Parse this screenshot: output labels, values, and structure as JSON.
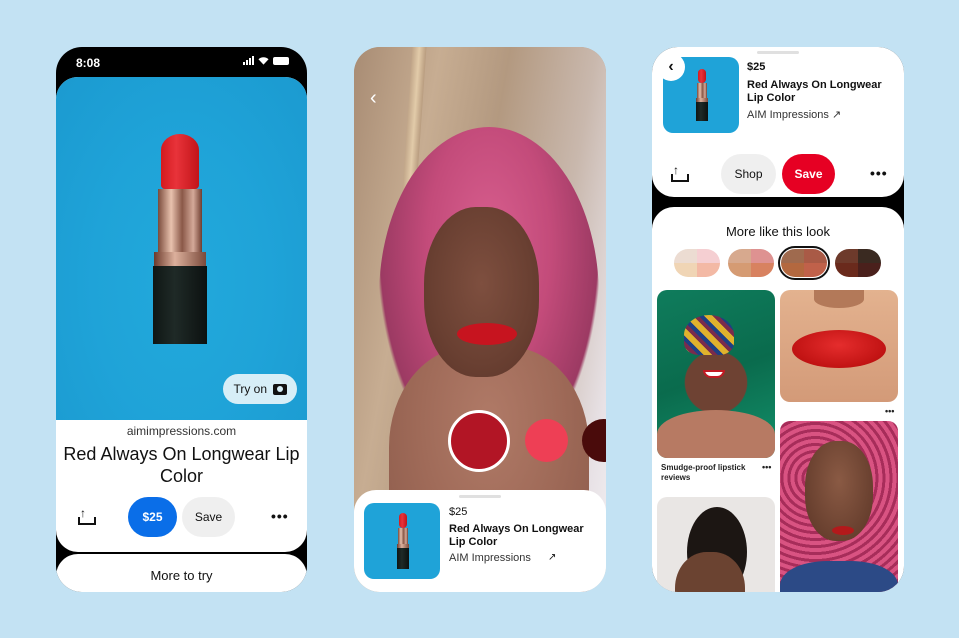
{
  "phone1": {
    "status_time": "8:08",
    "try_on_label": "Try on",
    "domain": "aimimpressions.com",
    "title": "Red Always On Longwear Lip Color",
    "price_button": "$25",
    "save_button": "Save",
    "more_label": "•••",
    "more_to_try": "More to try",
    "colors": {
      "price_button_bg": "#0a6ee8",
      "save_button_bg": "#efefef"
    }
  },
  "phone2": {
    "back_label": "‹",
    "shades": [
      {
        "name": "selected-red",
        "color": "#b21525"
      },
      {
        "name": "pink-red",
        "color": "#ee3f55"
      },
      {
        "name": "deep-burgundy",
        "color": "#4a0b0b"
      }
    ],
    "product": {
      "price": "$25",
      "name": "Red Always On Longwear Lip Color",
      "brand": "AIM Impressions",
      "link_arrow": "↗"
    }
  },
  "phone3": {
    "back_label": "‹",
    "product": {
      "price": "$25",
      "name": "Red Always On Longwear Lip Color",
      "brand": "AIM Impressions ↗"
    },
    "shop_button": "Shop",
    "save_button": "Save",
    "more_label": "•••",
    "section_title": "More like this look",
    "skin_tones": [
      {
        "name": "light",
        "colors": [
          "#ecdcd2",
          "#f5cfd2",
          "#f0d5b5",
          "#f3b9a5"
        ],
        "selected": false
      },
      {
        "name": "medium-light",
        "colors": [
          "#d7a98e",
          "#de9291",
          "#d59b73",
          "#d88260"
        ],
        "selected": false
      },
      {
        "name": "medium-dark",
        "colors": [
          "#9f6a4e",
          "#a95a46",
          "#b3683f",
          "#c0614a"
        ],
        "selected": true
      },
      {
        "name": "dark",
        "colors": [
          "#6d3a2b",
          "#3a2a21",
          "#6a2a1c",
          "#4a201c"
        ],
        "selected": false
      }
    ],
    "pins": [
      {
        "caption": "Smudge-proof lipstick reviews",
        "dots": "•••"
      },
      {
        "caption": "",
        "dots": "•••"
      }
    ],
    "colors": {
      "save_button_bg": "#e60023",
      "shop_button_bg": "#efefef"
    }
  }
}
